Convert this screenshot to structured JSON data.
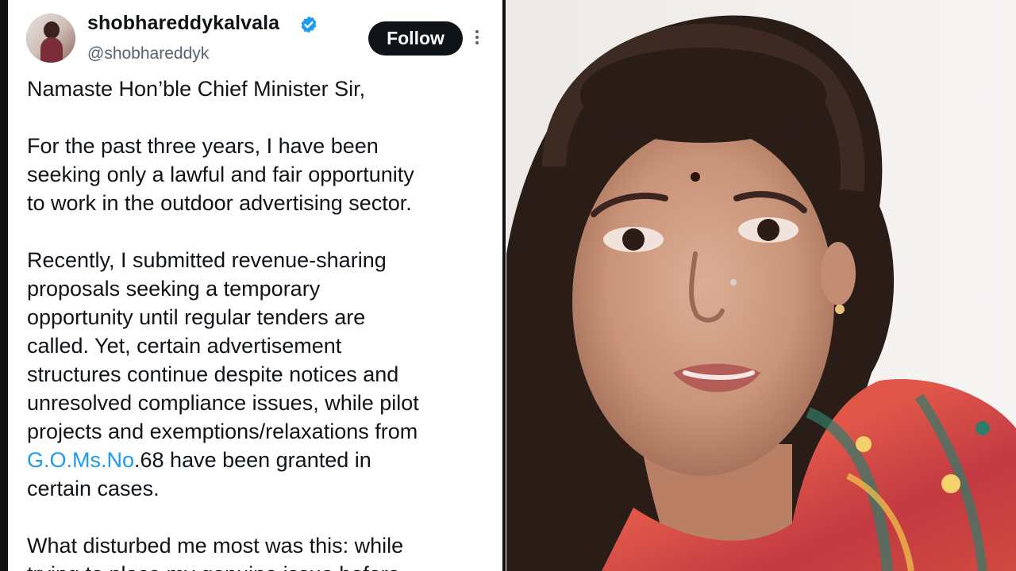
{
  "tweet": {
    "display_name": "shobhareddykalvala",
    "handle": "@shobhareddyk",
    "follow_label": "Follow",
    "paragraphs": [
      {
        "lines": [
          "Namaste Hon’ble Chief Minister Sir,"
        ]
      },
      {
        "lines": [
          "For the past three years, I have been",
          "seeking only a lawful and fair opportunity",
          "to work in the outdoor advertising sector."
        ]
      },
      {
        "lines": [
          "Recently, I submitted revenue-sharing",
          "proposals seeking a temporary",
          "opportunity until regular tenders are",
          "called. Yet, certain advertisement",
          "structures continue despite notices and",
          "unresolved compliance issues, while pilot",
          "projects and exemptions/relaxations from"
        ]
      },
      {
        "link_text": "G.O.Ms.No",
        "after_link": ".68 have been granted in",
        "last_line": "certain cases."
      },
      {
        "lines": [
          "What disturbed me most was this: while",
          "trying to place my genuine issue before"
        ]
      }
    ]
  },
  "colors": {
    "verified_blue": "#1d9bf0",
    "follow_bg": "#0f1419",
    "link_blue": "#1d9bf0",
    "text_dark": "#0f1419",
    "text_muted": "#536471"
  },
  "icons": {
    "verified": "verified-badge-icon",
    "more": "more-options-icon"
  }
}
